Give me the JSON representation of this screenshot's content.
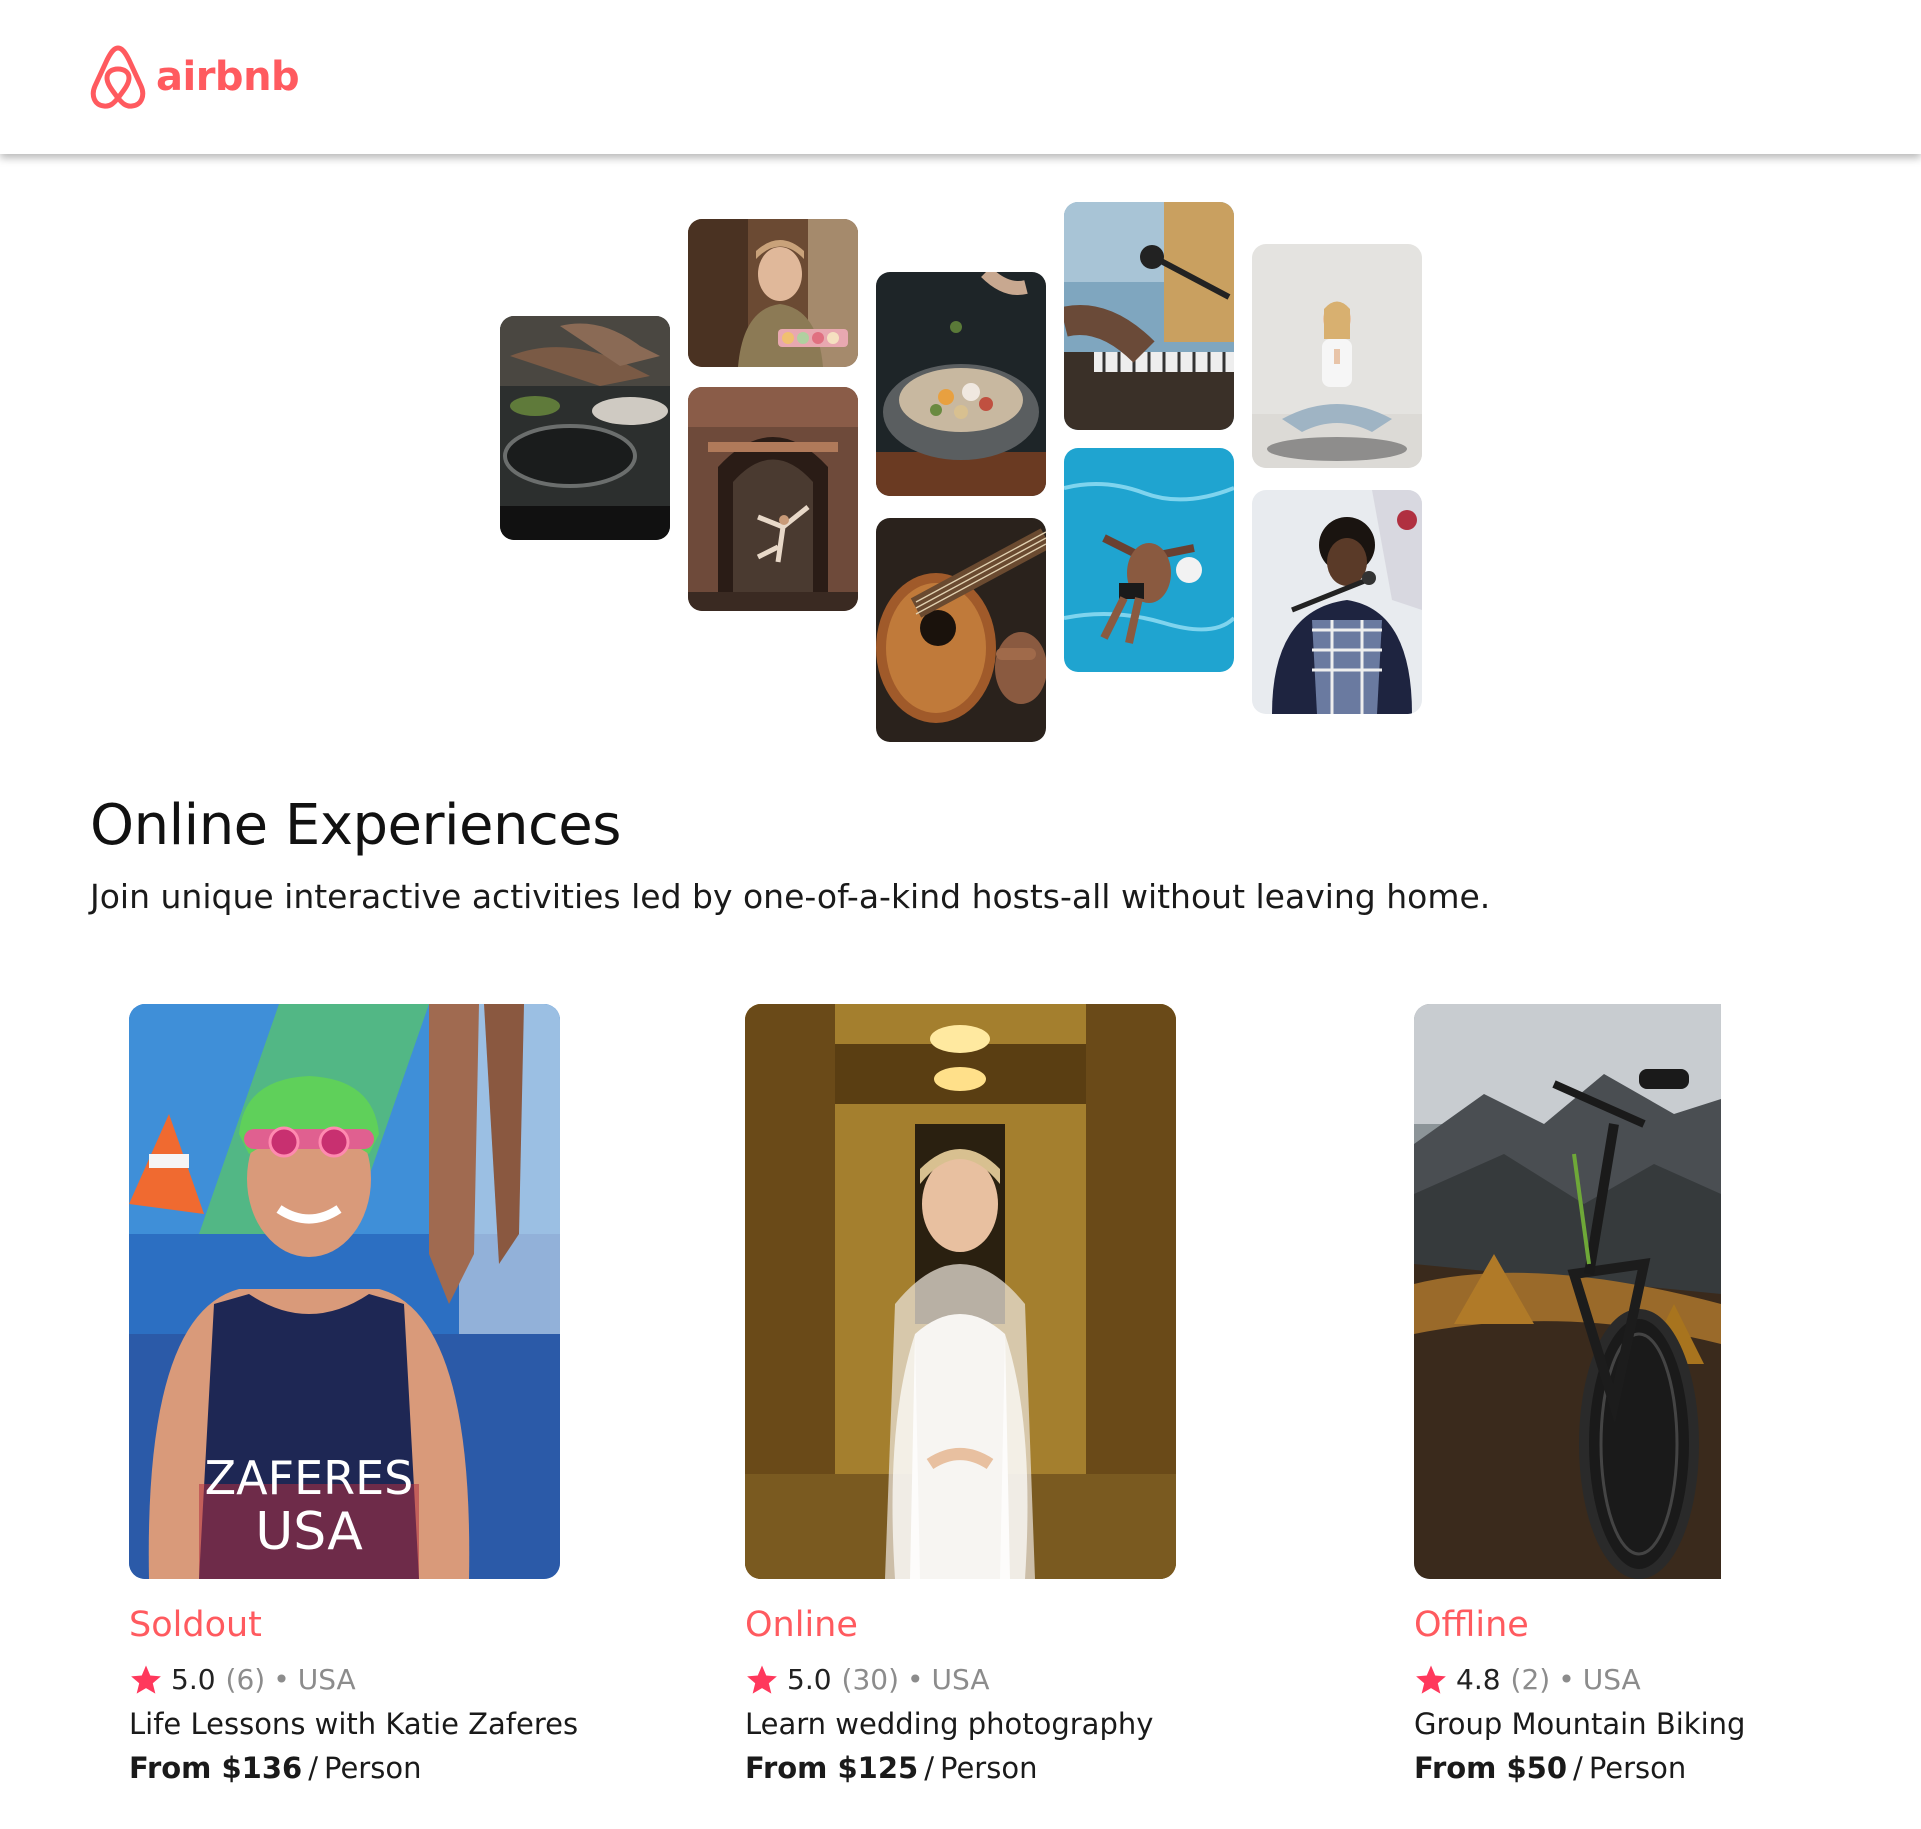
{
  "brand": {
    "logo_text": "airbnb",
    "color": "#ff5a5f"
  },
  "hero": {
    "photos": [
      "cooking-pans-photo",
      "chef-with-macarons-photo",
      "dancer-in-doorway-photo",
      "spice-bowl-photo",
      "acoustic-guitar-photo",
      "keyboard-microphone-photo",
      "swimmer-in-pool-photo",
      "yoga-meditation-photo",
      "singer-with-microphone-photo"
    ]
  },
  "section": {
    "title": "Online Experiences",
    "subtitle": "Join unique interactive activities led by one-of-a-kind hosts-all without leaving home."
  },
  "cards": [
    {
      "status": "Soldout",
      "rating": "5.0",
      "reviews": "(6)",
      "separator": "•",
      "country": "USA",
      "title": "Life Lessons with Katie Zaferes",
      "price": "From $136",
      "slash": "/",
      "unit": "Person",
      "photo_jersey_line1": "ZAFERES",
      "photo_jersey_line2": "USA"
    },
    {
      "status": "Online",
      "rating": "5.0",
      "reviews": "(30)",
      "separator": "•",
      "country": "USA",
      "title": "Learn wedding photography",
      "price": "From $125",
      "slash": "/",
      "unit": "Person"
    },
    {
      "status": "Offline",
      "rating": "4.8",
      "reviews": "(2)",
      "separator": "•",
      "country": "USA",
      "title": "Group Mountain Biking",
      "price": "From $50",
      "slash": "/",
      "unit": "Person"
    }
  ],
  "colors": {
    "accent": "#ff5a5f",
    "star": "#ff385c",
    "muted": "#8c8c8c"
  }
}
